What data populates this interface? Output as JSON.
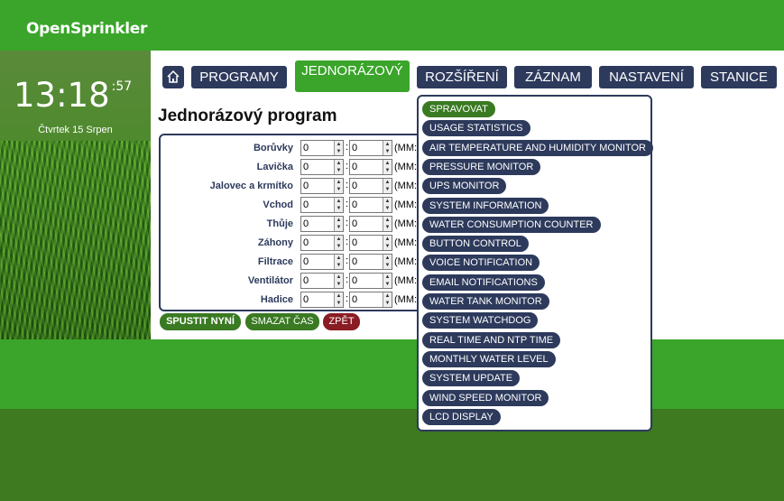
{
  "header": {
    "logo": "OpenSprinkler"
  },
  "clock": {
    "time": "13:18",
    "seconds": ":57",
    "date": "Čtvrtek 15 Srpen"
  },
  "nav": {
    "tabs": [
      {
        "label": "PROGRAMY",
        "active": false
      },
      {
        "label": "JEDNORÁZOVÝ",
        "active": true
      },
      {
        "label": "ROZŠÍŘENÍ",
        "active": false
      },
      {
        "label": "ZÁZNAM",
        "active": false
      },
      {
        "label": "NASTAVENÍ",
        "active": false
      },
      {
        "label": "STANICE",
        "active": false
      }
    ]
  },
  "page": {
    "title": "Jednorázový program"
  },
  "stations": [
    {
      "name": "Borůvky",
      "min": "0",
      "sec": "0"
    },
    {
      "name": "Lavička",
      "min": "0",
      "sec": "0"
    },
    {
      "name": "Jalovec a krmítko",
      "min": "0",
      "sec": "0"
    },
    {
      "name": "Vchod",
      "min": "0",
      "sec": "0"
    },
    {
      "name": "Thůje",
      "min": "0",
      "sec": "0"
    },
    {
      "name": "Záhony",
      "min": "0",
      "sec": "0"
    },
    {
      "name": "Filtrace",
      "min": "0",
      "sec": "0"
    },
    {
      "name": "Ventilátor",
      "min": "0",
      "sec": "0"
    },
    {
      "name": "Hadice",
      "min": "0",
      "sec": "0"
    }
  ],
  "unit_label": "(MM:",
  "buttons": {
    "run": "SPUSTIT NYNÍ",
    "clear": "SMAZAT ČAS",
    "back": "ZPĚT"
  },
  "extensions_menu": [
    "SPRAVOVAT",
    "USAGE STATISTICS",
    "AIR TEMPERATURE AND HUMIDITY MONITOR",
    "PRESSURE MONITOR",
    "UPS MONITOR",
    "SYSTEM INFORMATION",
    "WATER CONSUMPTION COUNTER",
    "BUTTON CONTROL",
    "VOICE NOTIFICATION",
    "EMAIL NOTIFICATIONS",
    "WATER TANK MONITOR",
    "SYSTEM WATCHDOG",
    "REAL TIME AND NTP TIME",
    "MONTHLY WATER LEVEL",
    "SYSTEM UPDATE",
    "WIND SPEED MONITOR",
    "LCD DISPLAY"
  ],
  "colors": {
    "brand_green": "#3aa52a",
    "dark_green": "#3d7a20",
    "navy": "#2d3a5c",
    "danger": "#8a1c24"
  },
  "icons": {
    "home": "home-icon",
    "spinner": "spin-arrows-icon"
  }
}
